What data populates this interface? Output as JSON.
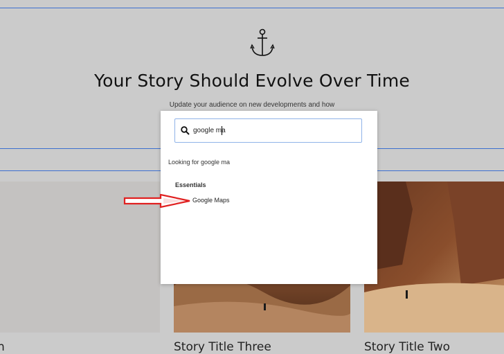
{
  "hero": {
    "headline": "Your Story Should Evolve Over Time",
    "subline": "Update your audience on new developments and how"
  },
  "cards": [
    {
      "title": "n"
    },
    {
      "title": "Story Title Three"
    },
    {
      "title": "Story Title Two"
    }
  ],
  "search_modal": {
    "query": "google ma",
    "looking_text": "Looking for google ma",
    "section_label": "Essentials",
    "results": [
      {
        "label": "Google Maps",
        "icon": "google-maps-icon"
      }
    ]
  },
  "colors": {
    "background": "#cbcbcb",
    "guide_line": "#3b6fd0",
    "arrow": "#e02020",
    "search_border": "#8fb3e8"
  }
}
